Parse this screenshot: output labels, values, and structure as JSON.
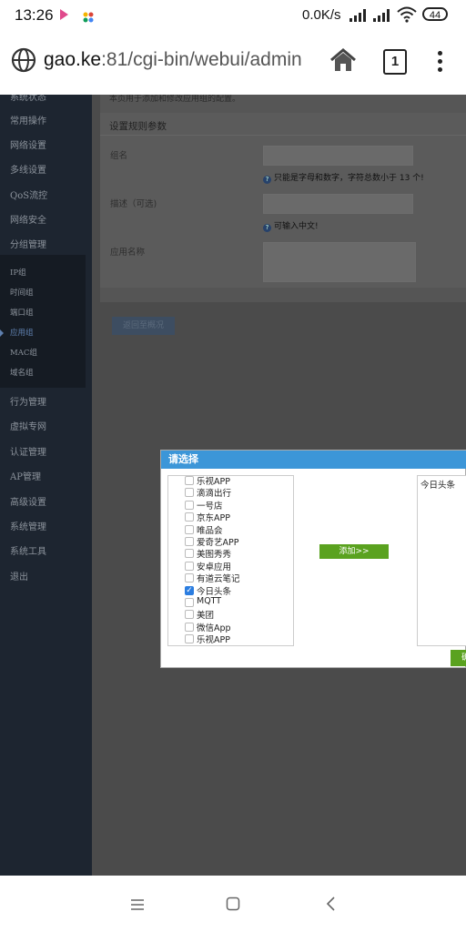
{
  "status_bar": {
    "time": "13:26",
    "network_speed": "0.0K/s",
    "battery": "44"
  },
  "browser": {
    "url_host": "gao.ke",
    "url_rest": ":81/cgi-bin/webui/admin",
    "tab_count": "1"
  },
  "sidebar": {
    "top_cut": "系统状态",
    "items": [
      "常用操作",
      "网络设置",
      "多线设置",
      "QoS流控",
      "网络安全",
      "分组管理"
    ],
    "submenu": [
      "IP组",
      "时间组",
      "端口组",
      "应用组",
      "MAC组",
      "域名组"
    ],
    "items_after": [
      "行为管理",
      "虚拟专网",
      "认证管理",
      "AP管理",
      "高级设置",
      "系统管理",
      "系统工具",
      "退出"
    ]
  },
  "content": {
    "intro": "本页用于添加和修改应用组的配置。",
    "section_title": "设置规则参数",
    "group_name_label": "组名",
    "group_name_hint": "只能是字母和数字，字符总数小于 13 个!",
    "desc_label": "描述（可选)",
    "desc_hint": "可输入中文!",
    "app_name_label": "应用名称",
    "back_button": "返回至概况"
  },
  "dialog": {
    "title": "请选择",
    "options": [
      {
        "label": "乐视APP",
        "checked": false
      },
      {
        "label": "滴滴出行",
        "checked": false
      },
      {
        "label": "一号店",
        "checked": false
      },
      {
        "label": "京东APP",
        "checked": false
      },
      {
        "label": "唯品会",
        "checked": false
      },
      {
        "label": "爱奇艺APP",
        "checked": false
      },
      {
        "label": "美图秀秀",
        "checked": false
      },
      {
        "label": "安卓应用",
        "checked": false
      },
      {
        "label": "有道云笔记",
        "checked": false
      },
      {
        "label": "今日头条",
        "checked": true
      },
      {
        "label": "MQTT",
        "checked": false
      },
      {
        "label": "美团",
        "checked": false
      },
      {
        "label": "微信App",
        "checked": false
      },
      {
        "label": "乐视APP",
        "checked": false
      }
    ],
    "add_button": "添加>>",
    "selected": [
      "今日头条"
    ],
    "ok_button": "确定"
  }
}
